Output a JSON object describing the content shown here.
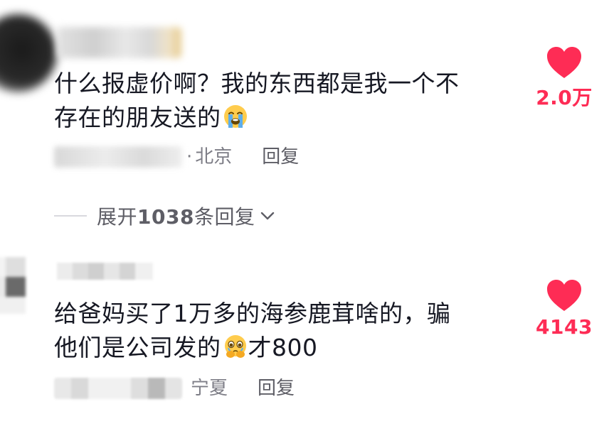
{
  "comments": [
    {
      "text_line1": "什么报虚价啊？我的东西都是我一个不",
      "text_line2": "存在的朋友送的",
      "emoji": "loudly-crying-face-emoji",
      "location": "北京",
      "dot": "·",
      "reply_label": "回复",
      "like_count": "2.0万",
      "expand": {
        "prefix": "展开",
        "count": "1038",
        "suffix": "条回复"
      }
    },
    {
      "text_line1": "给爸妈买了1万多的海参鹿茸啥的，骗",
      "text_line2_before": "他们是公司发的",
      "emoji": "face-holding-back-tears-emoji",
      "text_line2_after": "才800",
      "location": "宁夏",
      "reply_label": "回复",
      "like_count": "4143"
    }
  ],
  "colors": {
    "like": "#fe2c55",
    "text": "#161823",
    "meta": "#7d7d86",
    "reply": "#5e5e66"
  }
}
